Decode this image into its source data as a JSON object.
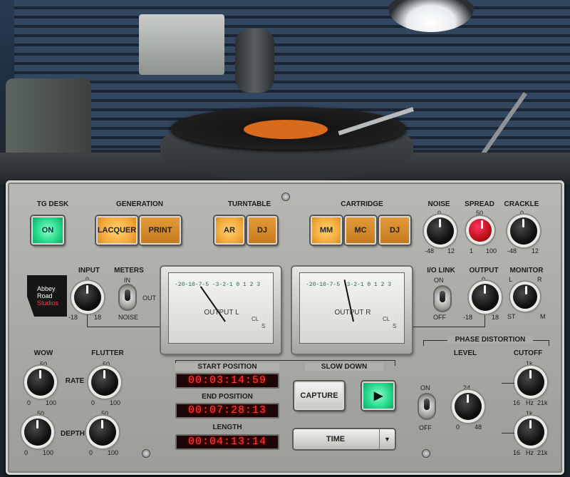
{
  "tg_desk": {
    "title": "TG DESK",
    "on_label": "ON"
  },
  "generation": {
    "title": "GENERATION",
    "lacquer": "LACQUER",
    "print": "PRINT"
  },
  "turntable": {
    "title": "TURNTABLE",
    "ar": "AR",
    "dj": "DJ"
  },
  "cartridge": {
    "title": "CARTRIDGE",
    "mm": "MM",
    "mc": "MC",
    "dj": "DJ"
  },
  "noise": {
    "title": "NOISE",
    "top": "0",
    "min": "-48",
    "max": "12"
  },
  "spread": {
    "title": "SPREAD",
    "top": "50",
    "min": "1",
    "max": "100"
  },
  "crackle": {
    "title": "CRACKLE",
    "top": "0",
    "min": "-48",
    "max": "12"
  },
  "input": {
    "title": "INPUT",
    "top": "0",
    "min": "-18",
    "max": "18"
  },
  "meters": {
    "title": "METERS",
    "in": "IN",
    "out": "OUT",
    "noise": "NOISE"
  },
  "logo": {
    "line1": "Abbey",
    "line2": "Road",
    "line3": "Studios"
  },
  "meter_l": {
    "name": "OUTPUT L",
    "scale": "-20-10-7-5  -3-2-1  0  1  2  3",
    "cl": "CL",
    "s": "S"
  },
  "meter_r": {
    "name": "OUTPUT R",
    "scale": "-20-10-7-5  -3-2-1  0  1  2  3",
    "cl": "CL",
    "s": "S"
  },
  "io_link": {
    "title": "I/O LINK",
    "on": "ON",
    "off": "OFF"
  },
  "output": {
    "title": "OUTPUT",
    "top": "0",
    "min": "-18",
    "max": "18"
  },
  "monitor": {
    "title": "MONITOR",
    "l": "L",
    "r": "R",
    "st": "ST",
    "m": "M"
  },
  "wow": {
    "title": "WOW",
    "rate_label": "RATE",
    "depth_label": "DEPTH",
    "rate_top": "50",
    "rate_min": "0",
    "rate_max": "100",
    "depth_top": "50",
    "depth_min": "0",
    "depth_max": "100"
  },
  "flutter": {
    "title": "FLUTTER",
    "rate_top": "50",
    "rate_min": "0",
    "rate_max": "100",
    "depth_top": "50",
    "depth_min": "0",
    "depth_max": "100"
  },
  "positions": {
    "start_label": "START POSITION",
    "start": "00:03:14:59",
    "end_label": "END POSITION",
    "end": "00:07:28:13",
    "length_label": "LENGTH",
    "length": "00:04:13:14"
  },
  "slow_down": {
    "title": "SLOW DOWN",
    "capture": "CAPTURE",
    "play_icon": "▶",
    "mode": "TIME"
  },
  "phase": {
    "title": "PHASE DISTORTION",
    "level": "LEVEL",
    "cutoff": "CUTOFF",
    "on": "ON",
    "off": "OFF",
    "level_top": "24",
    "level_min": "0",
    "level_max": "48",
    "cut1_top": "1k",
    "cut1_min": "16",
    "cut1_unit": "Hz",
    "cut1_max": "21k",
    "cut2_top": "1k",
    "cut2_min": "16",
    "cut2_unit": "Hz",
    "cut2_max": "21k"
  }
}
